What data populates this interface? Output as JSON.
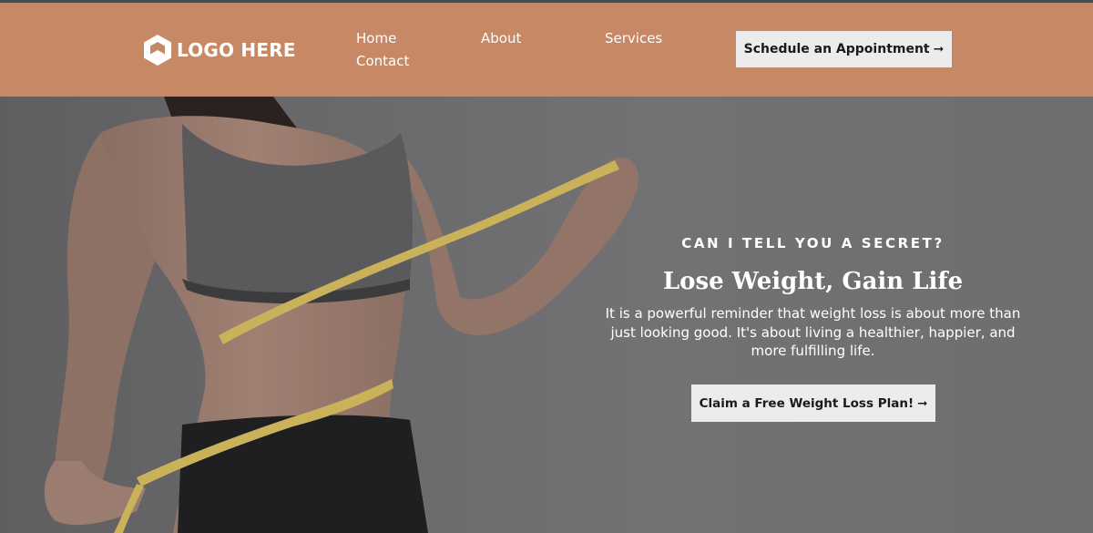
{
  "brand": {
    "logo_text": "LOGO HERE",
    "logo_icon": "hexagon-logo-icon"
  },
  "nav": {
    "items": [
      "Home",
      "About",
      "Services",
      "Contact"
    ]
  },
  "header": {
    "cta_label": "Schedule an Appointment",
    "cta_icon": "arrow-right-icon"
  },
  "hero": {
    "eyebrow": "CAN I TELL YOU A SECRET?",
    "headline": "Lose Weight, Gain Life",
    "subtext": "It is a powerful reminder that weight loss is about more than just looking good. It's about living a healthier, happier, and more fulfilling life.",
    "cta_label": "Claim a Free Weight Loss Plan!",
    "cta_icon": "arrow-right-icon",
    "image": "woman-measuring-waist-image"
  },
  "colors": {
    "header_bg": "#c78866",
    "button_bg": "#ececec",
    "hero_overlay": "#6e6e70"
  }
}
